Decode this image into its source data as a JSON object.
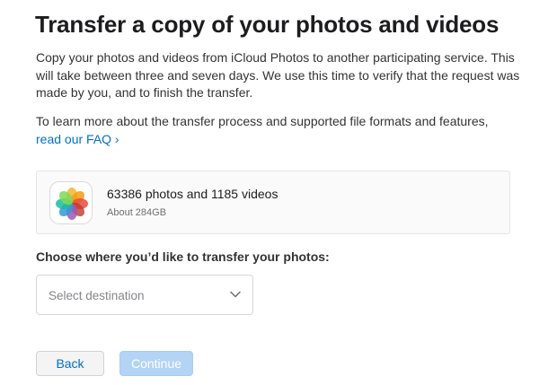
{
  "title": "Transfer a copy of your photos and videos",
  "intro": "Copy your photos and videos from iCloud Photos to another participating service. This will take between three and seven days. We use this time to verify that the request was made by you, and to finish the transfer.",
  "learn_more": {
    "text": "To learn more about the transfer process and supported file formats and features,",
    "link_label": "read our FAQ ›"
  },
  "summary": {
    "icon": "photos-app-icon",
    "counts": "63386 photos and 1185 videos",
    "size": "About 284GB"
  },
  "destination": {
    "label": "Choose where you’d like to transfer your photos:",
    "placeholder": "Select destination",
    "icon": "chevron-down-icon"
  },
  "buttons": {
    "back": "Back",
    "continue": "Continue"
  },
  "colors": {
    "link": "#0070c9",
    "continue_disabled": "#b3d4f5",
    "text": "#1d1d1f"
  }
}
